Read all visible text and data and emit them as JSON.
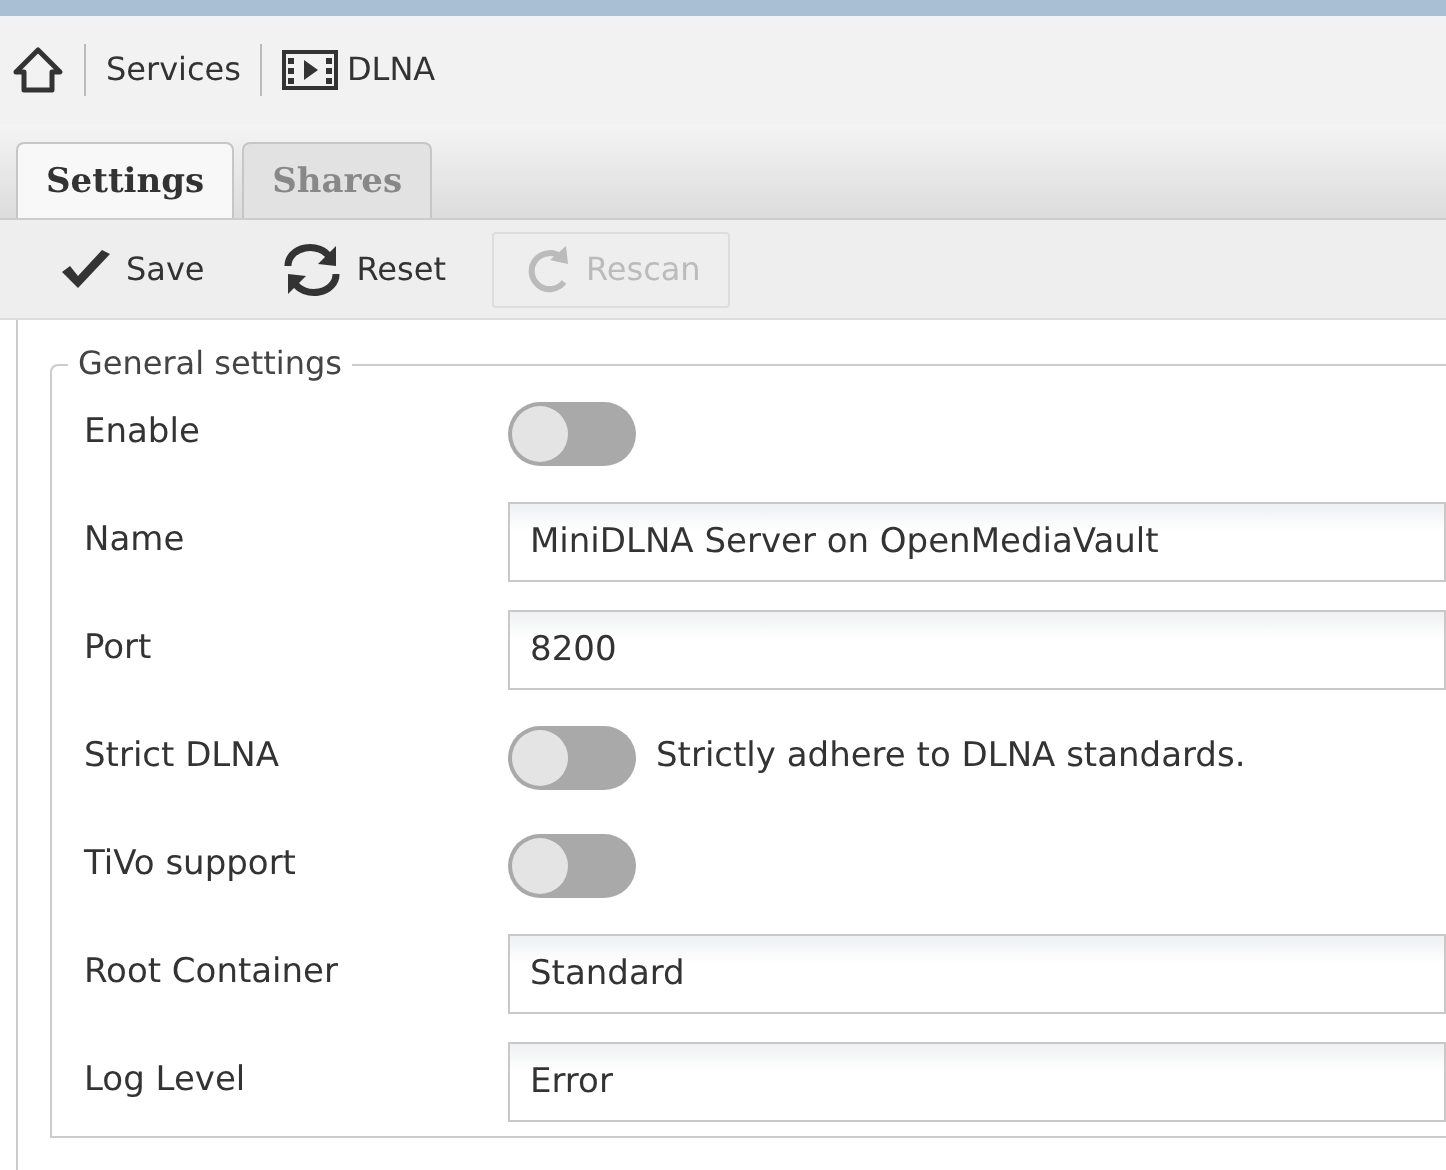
{
  "breadcrumb": [
    {
      "kind": "home"
    },
    {
      "kind": "text",
      "label": "Services"
    },
    {
      "kind": "film",
      "label": "DLNA"
    }
  ],
  "tabs": [
    {
      "label": "Settings",
      "selected": true
    },
    {
      "label": "Shares",
      "selected": false
    }
  ],
  "toolbar": [
    {
      "kind": "check",
      "label": "Save",
      "disabled": false
    },
    {
      "kind": "refresh",
      "label": "Reset",
      "disabled": false
    },
    {
      "kind": "rescan",
      "label": "Rescan",
      "disabled": true
    }
  ],
  "fieldset": {
    "legend": "General settings",
    "fields": [
      {
        "kind": "switch",
        "label": "Enable",
        "on": false
      },
      {
        "kind": "text",
        "label": "Name",
        "value": "MiniDLNA Server on OpenMediaVault"
      },
      {
        "kind": "text",
        "label": "Port",
        "value": "8200"
      },
      {
        "kind": "switch",
        "label": "Strict DLNA",
        "on": false,
        "note": "Strictly adhere to DLNA standards."
      },
      {
        "kind": "switch",
        "label": "TiVo support",
        "on": false
      },
      {
        "kind": "text",
        "label": "Root Container",
        "value": "Standard"
      },
      {
        "kind": "text",
        "label": "Log Level",
        "value": "Error"
      }
    ]
  }
}
